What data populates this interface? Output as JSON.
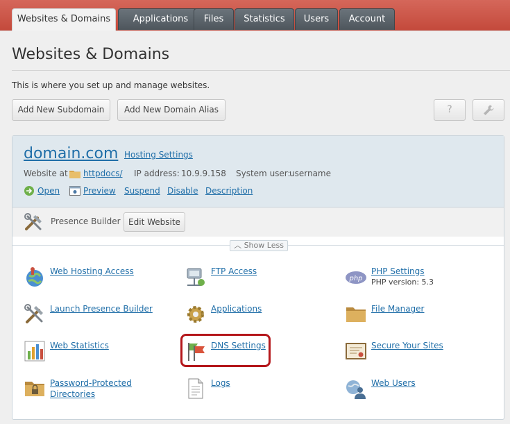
{
  "tabs": [
    {
      "label": "Websites & Domains",
      "active": true
    },
    {
      "label": "Applications",
      "active": false
    },
    {
      "label": "Files",
      "active": false
    },
    {
      "label": "Statistics",
      "active": false
    },
    {
      "label": "Users",
      "active": false
    },
    {
      "label": "Account",
      "active": false
    }
  ],
  "page": {
    "title": "Websites & Domains",
    "description": "This is where you set up and manage websites."
  },
  "actions": {
    "add_subdomain": "Add New Subdomain",
    "add_alias": "Add New Domain Alias",
    "help": "?",
    "settings_icon": "wrench-icon"
  },
  "domain": {
    "name": "domain.com",
    "hosting_settings": "Hosting Settings",
    "website_at_label": "Website at",
    "docroot": "httpdocs/",
    "ip_label": "IP address:",
    "ip": "10.9.9.158",
    "sysuser_label": "System user:",
    "sysuser": "username",
    "links": {
      "open": "Open",
      "preview": "Preview",
      "suspend": "Suspend",
      "disable": "Disable",
      "description": "Description"
    }
  },
  "builder": {
    "label": "Presence Builder",
    "edit_button": "Edit Website"
  },
  "show_less": "Show Less",
  "tools": [
    {
      "label": "Web Hosting Access",
      "icon": "globe-person-icon"
    },
    {
      "label": "FTP Access",
      "icon": "ftp-server-icon"
    },
    {
      "label": "PHP Settings",
      "sub": "PHP version: 5.3",
      "icon": "php-icon"
    },
    {
      "label": "Launch Presence Builder",
      "icon": "tools-icon"
    },
    {
      "label": "Applications",
      "icon": "gear-icon"
    },
    {
      "label": "File Manager",
      "icon": "folder-icon"
    },
    {
      "label": "Web Statistics",
      "icon": "bar-chart-icon"
    },
    {
      "label": "DNS Settings",
      "icon": "flags-icon"
    },
    {
      "label": "Secure Your Sites",
      "icon": "certificate-icon"
    },
    {
      "label_line1": "Password-Protected",
      "label_line2": "Directories",
      "icon": "locked-folder-icon"
    },
    {
      "label": "Logs",
      "icon": "document-icon"
    },
    {
      "label": "Web Users",
      "icon": "web-user-icon"
    }
  ],
  "colors": {
    "topbar": "#c9503f",
    "tab_inactive": "#5a636a",
    "link": "#1f6ea8",
    "highlight": "#b4171b",
    "panel_head": "#dfe8ee"
  }
}
